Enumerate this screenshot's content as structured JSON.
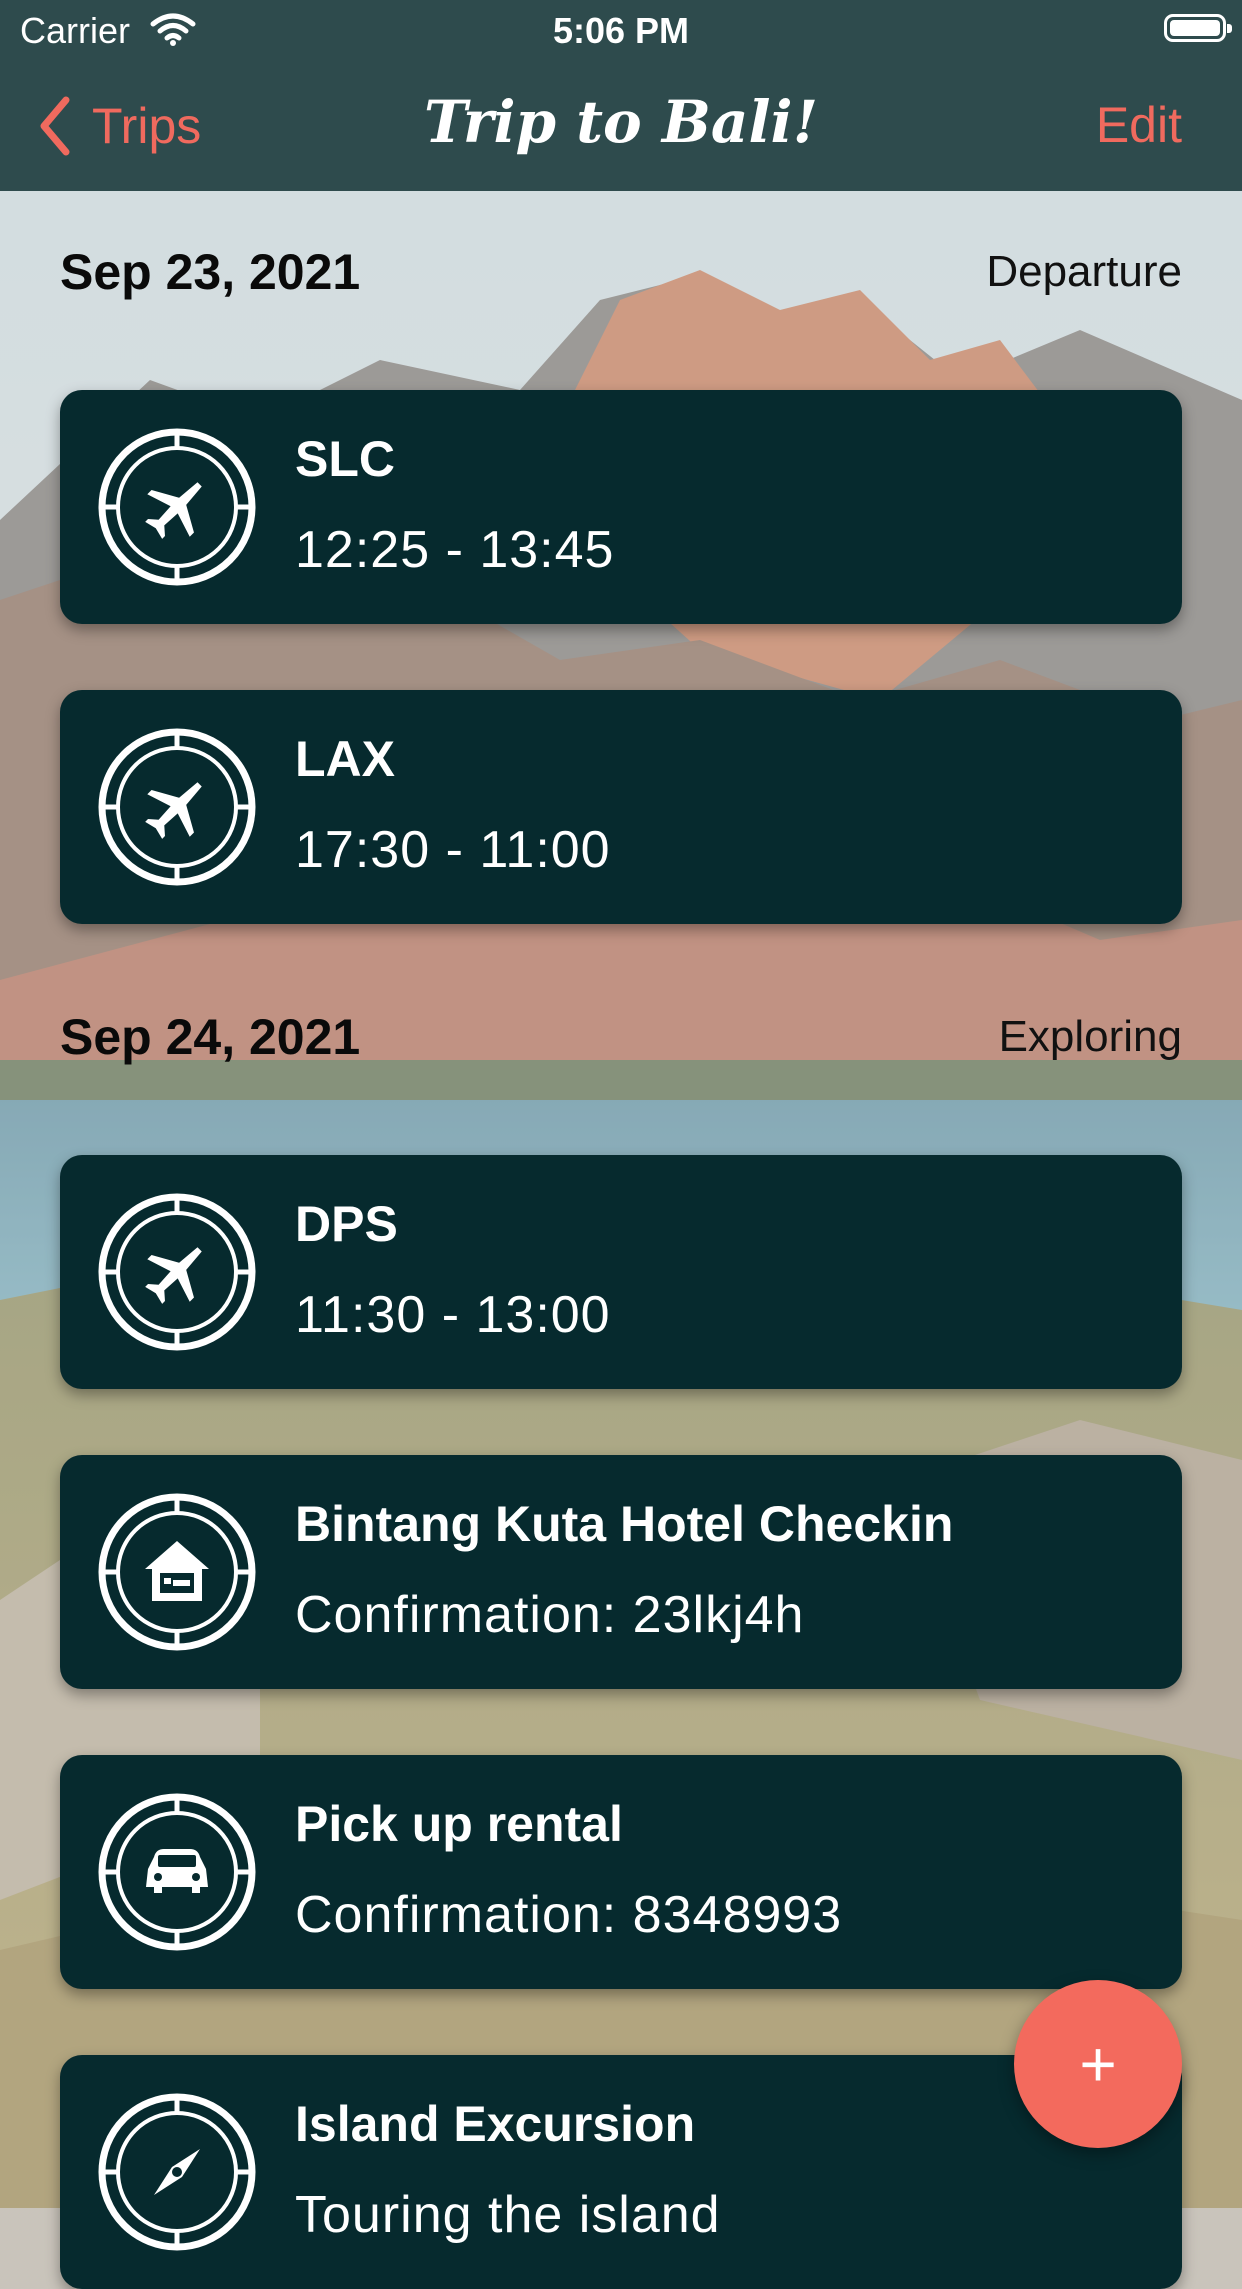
{
  "status_bar": {
    "carrier": "Carrier",
    "time": "5:06 PM"
  },
  "nav": {
    "back_label": "Trips",
    "title": "Trip to Bali!",
    "edit_label": "Edit"
  },
  "colors": {
    "nav_bg": "#2e4b4d",
    "accent": "#f06a5e",
    "card_bg": "#062a2e",
    "fab": "#f36a5d"
  },
  "sections": [
    {
      "date": "Sep 23, 2021",
      "label": "Departure",
      "items": [
        {
          "icon": "airplane-icon",
          "title": "SLC",
          "subtitle": "12:25 - 13:45"
        },
        {
          "icon": "airplane-icon",
          "title": "LAX",
          "subtitle": "17:30 - 11:00"
        }
      ]
    },
    {
      "date": "Sep 24, 2021",
      "label": "Exploring",
      "items": [
        {
          "icon": "airplane-icon",
          "title": "DPS",
          "subtitle": "11:30 - 13:00"
        },
        {
          "icon": "hotel-icon",
          "title": "Bintang Kuta Hotel Checkin",
          "subtitle": "Confirmation: 23lkj4h"
        },
        {
          "icon": "car-icon",
          "title": "Pick up rental",
          "subtitle": "Confirmation: 8348993"
        },
        {
          "icon": "compass-icon",
          "title": "Island Excursion",
          "subtitle": "Touring the island"
        }
      ]
    }
  ],
  "fab": {
    "label": "+"
  }
}
